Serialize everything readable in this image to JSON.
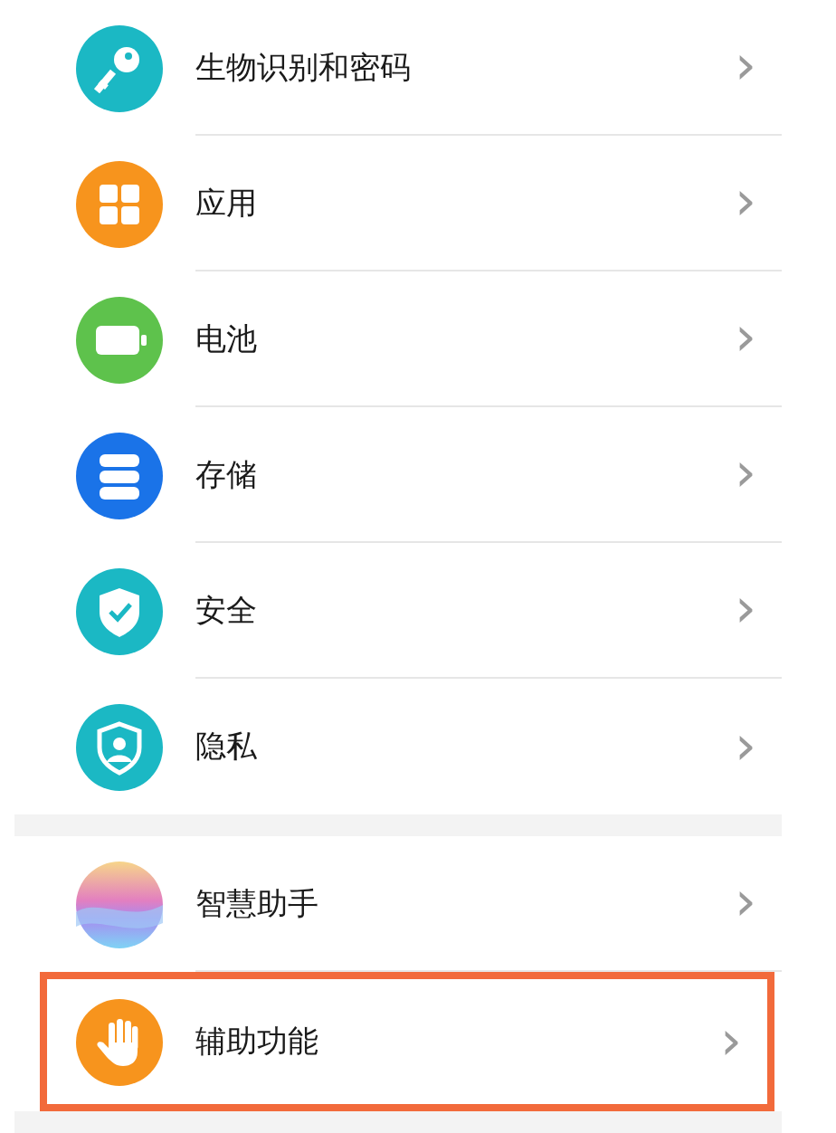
{
  "groups": [
    {
      "items": [
        {
          "kind": "biometrics",
          "label": "生物识别和密码",
          "highlighted": false
        },
        {
          "kind": "apps",
          "label": "应用",
          "highlighted": false
        },
        {
          "kind": "battery",
          "label": "电池",
          "highlighted": false
        },
        {
          "kind": "storage",
          "label": "存储",
          "highlighted": false
        },
        {
          "kind": "security",
          "label": "安全",
          "highlighted": false
        },
        {
          "kind": "privacy",
          "label": "隐私",
          "highlighted": false
        }
      ]
    },
    {
      "items": [
        {
          "kind": "assistant",
          "label": "智慧助手",
          "highlighted": false
        },
        {
          "kind": "accessibility",
          "label": "辅助功能",
          "highlighted": true
        }
      ]
    }
  ],
  "chevron": "›"
}
